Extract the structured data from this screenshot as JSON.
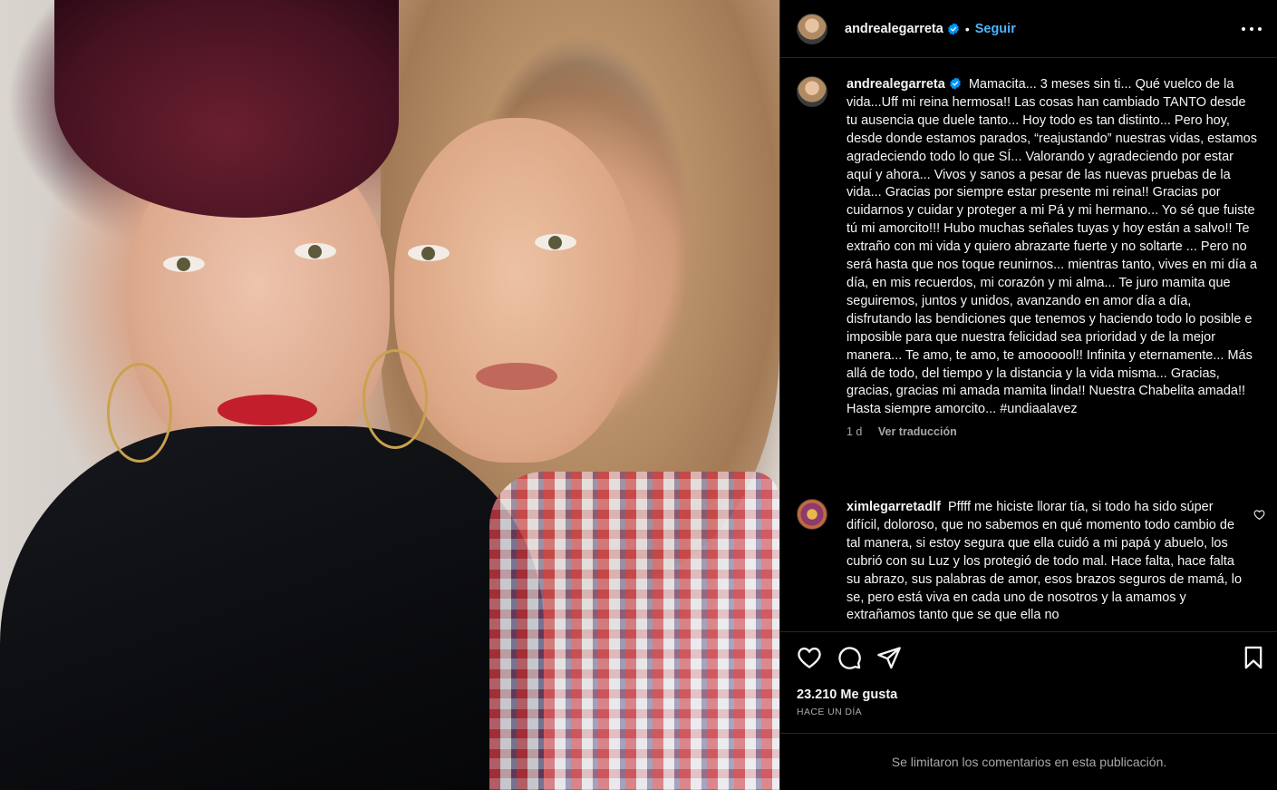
{
  "post": {
    "username": "andrealegarreta",
    "follow_label": "Seguir",
    "separator": "•",
    "caption_text": "Mamacita... 3 meses sin ti... Qué vuelco de la vida...Uff mi reina hermosa!! Las cosas han cambiado TANTO desde tu ausencia que duele tanto... Hoy todo es tan distinto... Pero hoy, desde donde estamos parados, “reajustando” nuestras vidas, estamos agradeciendo todo lo que SÍ... Valorando y agradeciendo por estar aquí y ahora... Vivos y sanos a pesar de las nuevas pruebas de la vida... Gracias por siempre estar presente mi reina!! Gracias por cuidarnos y cuidar y proteger a mi Pá y mi hermano... Yo sé que fuiste tú mi amorcito!!! Hubo muchas señales tuyas y hoy están a salvo!! Te extraño con mi vida y quiero abrazarte fuerte y no soltarte ... Pero no será hasta que nos toque reunirnos... mientras tanto, vives en mi día a día, en mis recuerdos, mi corazón y mi alma... Te juro mamita que seguiremos, juntos y unidos, avanzando en amor día a día, disfrutando las bendiciones que tenemos y haciendo todo lo posible e imposible para que nuestra felicidad sea prioridad y de la mejor manera... Te amo, te amo, te amoooool!! Infinita y eternamente... Más allá de todo, del tiempo y la distancia y la vida misma... Gracias, gracias, gracias mi amada mamita linda!! Nuestra Chabelita amada!! Hasta siempre amorcito... #undiaalavez",
    "caption_age": "1 d",
    "translate_label": "Ver traducción",
    "likes_label": "23.210 Me gusta",
    "posted_label": "HACE UN DÍA",
    "comments_limited": "Se limitaron los comentarios en esta publicación."
  },
  "comment": {
    "username": "ximlegarretadlf",
    "text": "Pffff me hiciste llorar tía, si todo ha sido súper difícil, doloroso, que no sabemos en qué momento todo cambio de tal manera, si estoy segura que ella cuidó a mi papá y abuelo, los cubrió con su Luz y los protegió de todo mal. Hace falta, hace falta su abrazo, sus palabras de amor, esos brazos seguros de mamá, lo se, pero está viva en cada uno de nosotros y la amamos y extrañamos tanto que se que ella no"
  },
  "icons": {
    "verified": "verified-badge-icon",
    "more": "more-options-icon",
    "like": "heart-icon",
    "comment": "comment-icon",
    "share": "paper-plane-icon",
    "save": "bookmark-icon"
  },
  "colors": {
    "background": "#000000",
    "link_blue": "#4cb5f9",
    "verified_blue": "#0095f6",
    "muted_text": "#a8a8a8",
    "divider": "#262626"
  }
}
